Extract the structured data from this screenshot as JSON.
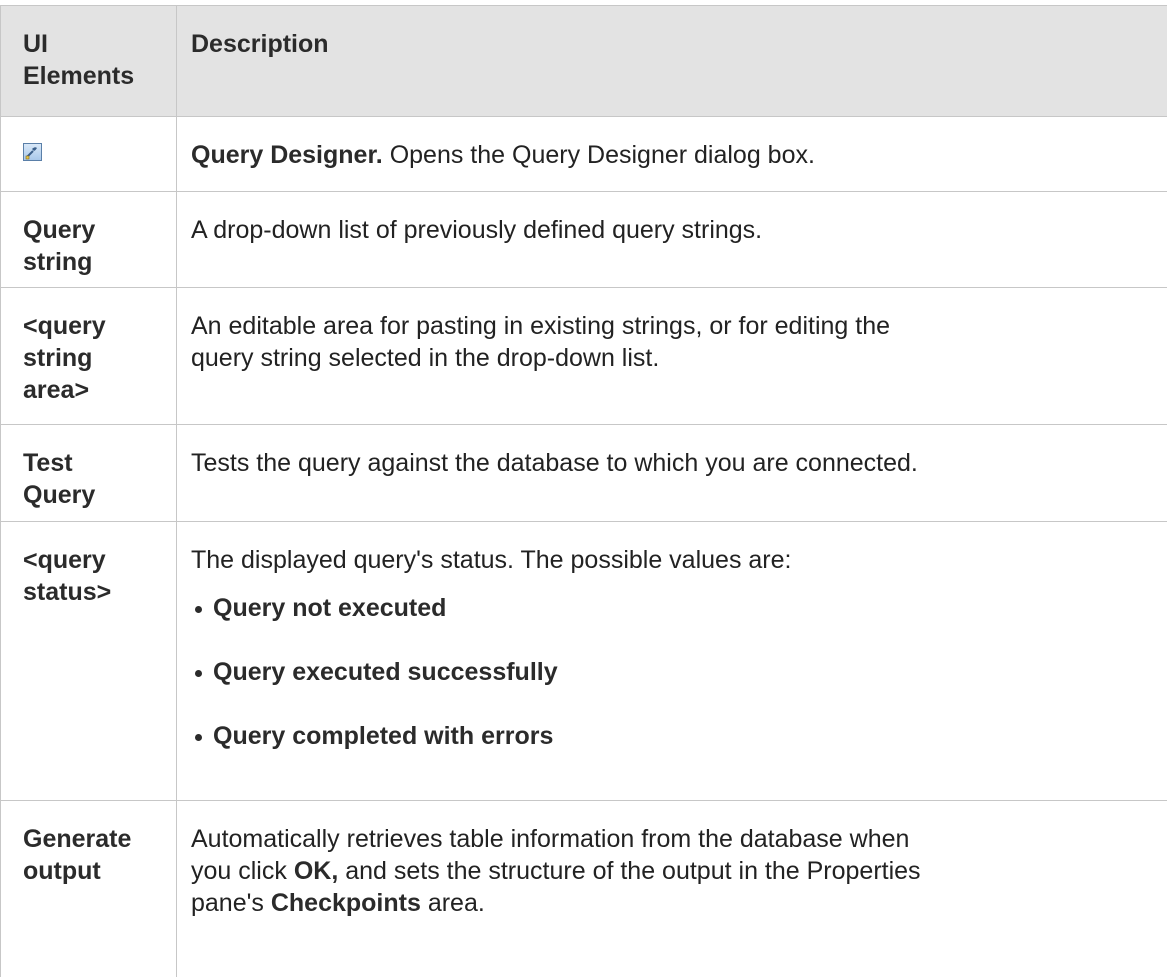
{
  "table": {
    "headers": {
      "col1": [
        "UI",
        "Elements"
      ],
      "col2": "Description"
    },
    "rows": {
      "query_designer": {
        "icon": "query-designer-icon",
        "bold": "Query Designer.",
        "text": " Opens the Query Designer dialog box."
      },
      "query_string": {
        "name": [
          "Query",
          "string"
        ],
        "text": "A drop-down list of previously defined query strings."
      },
      "query_string_area": {
        "name": [
          "<query",
          "string",
          "area>"
        ],
        "text": [
          "An editable area for pasting in existing strings, or for editing the",
          "query string selected in the drop-down list."
        ]
      },
      "test_query": {
        "name": [
          "Test",
          "Query"
        ],
        "text": "Tests the query against the database to which you are connected."
      },
      "query_status": {
        "name": [
          "<query",
          "status>"
        ],
        "text": "The displayed query's status. The possible values are:",
        "values": [
          "Query not executed",
          "Query executed successfully",
          "Query completed with errors"
        ]
      },
      "generate_output": {
        "name": [
          "Generate",
          "output"
        ],
        "text_line1": "Automatically retrieves table information from the database when",
        "text_line2_a": "you click ",
        "text_line2_bold": "OK,",
        "text_line2_b": " and sets the structure of the output in the Properties",
        "text_line3_a": "pane's ",
        "text_line3_bold": "Checkpoints",
        "text_line3_b": " area."
      }
    }
  },
  "colors": {
    "header_bg": "#e3e3e3",
    "border": "#c7c7c7",
    "text": "#222222"
  }
}
